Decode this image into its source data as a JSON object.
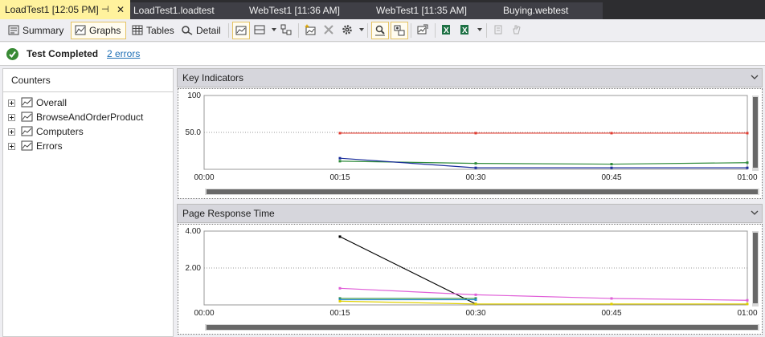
{
  "tabs": [
    {
      "label": "LoadTest1 [12:05 PM]",
      "active": true
    },
    {
      "label": "LoadTest1.loadtest",
      "active": false
    },
    {
      "label": "WebTest1 [11:36 AM]",
      "active": false
    },
    {
      "label": "WebTest1 [11:35 AM]",
      "active": false
    },
    {
      "label": "Buying.webtest",
      "active": false
    }
  ],
  "tab_pin_glyph": "⊣",
  "tab_close_glyph": "✕",
  "toolbar": {
    "summary_label": "Summary",
    "graphs_label": "Graphs",
    "tables_label": "Tables",
    "detail_label": "Detail"
  },
  "status": {
    "text": "Test Completed",
    "errors_link": "2 errors"
  },
  "counters": {
    "header": "Counters",
    "items": [
      "Overall",
      "BrowseAndOrderProduct",
      "Computers",
      "Errors"
    ]
  },
  "colors": {
    "accent_tab": "#fff29d",
    "success": "#388a34",
    "link": "#1e6fb5"
  },
  "chart_data": [
    {
      "type": "line",
      "title": "Key Indicators",
      "x": [
        "00:00",
        "00:15",
        "00:30",
        "00:45",
        "01:00"
      ],
      "y_ticks": [
        "100",
        "50.0"
      ],
      "ylim": [
        0,
        100
      ],
      "grid": true,
      "series": [
        {
          "color": "#e03c31",
          "points": [
            [
              1,
              49
            ],
            [
              2,
              49
            ],
            [
              3,
              49
            ],
            [
              4,
              49
            ]
          ]
        },
        {
          "color": "#2e8b3a",
          "points": [
            [
              1,
              11
            ],
            [
              2,
              8
            ],
            [
              3,
              7
            ],
            [
              4,
              9
            ]
          ]
        },
        {
          "color": "#1a2d9c",
          "points": [
            [
              1,
              15
            ],
            [
              2,
              2
            ],
            [
              3,
              2
            ],
            [
              4,
              2
            ]
          ]
        }
      ]
    },
    {
      "type": "line",
      "title": "Page Response Time",
      "x": [
        "00:00",
        "00:15",
        "00:30",
        "00:45",
        "01:00"
      ],
      "y_ticks": [
        "4.00",
        "2.00"
      ],
      "ylim": [
        0,
        4
      ],
      "grid": true,
      "series": [
        {
          "color": "#000000",
          "points": [
            [
              1,
              3.7
            ],
            [
              2,
              0.05
            ]
          ]
        },
        {
          "color": "#e05fd8",
          "points": [
            [
              1,
              0.9
            ],
            [
              2,
              0.55
            ],
            [
              3,
              0.35
            ],
            [
              4,
              0.25
            ]
          ]
        },
        {
          "color": "#2e8b3a",
          "points": [
            [
              1,
              0.35
            ],
            [
              2,
              0.35
            ]
          ]
        },
        {
          "color": "#2a8dd4",
          "points": [
            [
              1,
              0.28
            ],
            [
              2,
              0.28
            ]
          ]
        },
        {
          "color": "#e0d000",
          "points": [
            [
              1,
              0.2
            ],
            [
              2,
              0.05
            ],
            [
              3,
              0.05
            ],
            [
              4,
              0.05
            ]
          ]
        }
      ]
    }
  ]
}
